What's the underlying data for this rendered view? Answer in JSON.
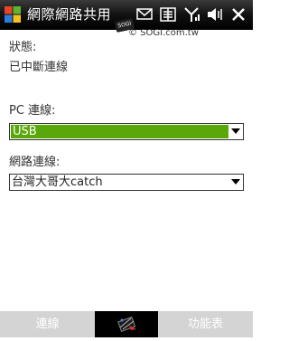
{
  "titlebar": {
    "app_title": "網際網路共用",
    "logo_icon": "windows-logo-icon",
    "tray_icons": [
      "mail-icon",
      "keyboard-icon",
      "signal-icon",
      "volume-icon",
      "close-icon"
    ]
  },
  "watermark": {
    "badge": "SOGI",
    "text": "© SOGI.com.tw"
  },
  "status": {
    "label": "狀態:",
    "value": "已中斷連線"
  },
  "pc_connection": {
    "label": "PC 連線:",
    "selected": "USB"
  },
  "network_connection": {
    "label": "網路連線:",
    "selected": "台灣大哥大catch"
  },
  "softkeys": {
    "left": "連線",
    "right": "功能表",
    "center_icon": "keyboard-input-icon"
  },
  "colors": {
    "accent": "#5aa70a",
    "titlebar": "#000000",
    "softbar": "#d4d4d4"
  }
}
